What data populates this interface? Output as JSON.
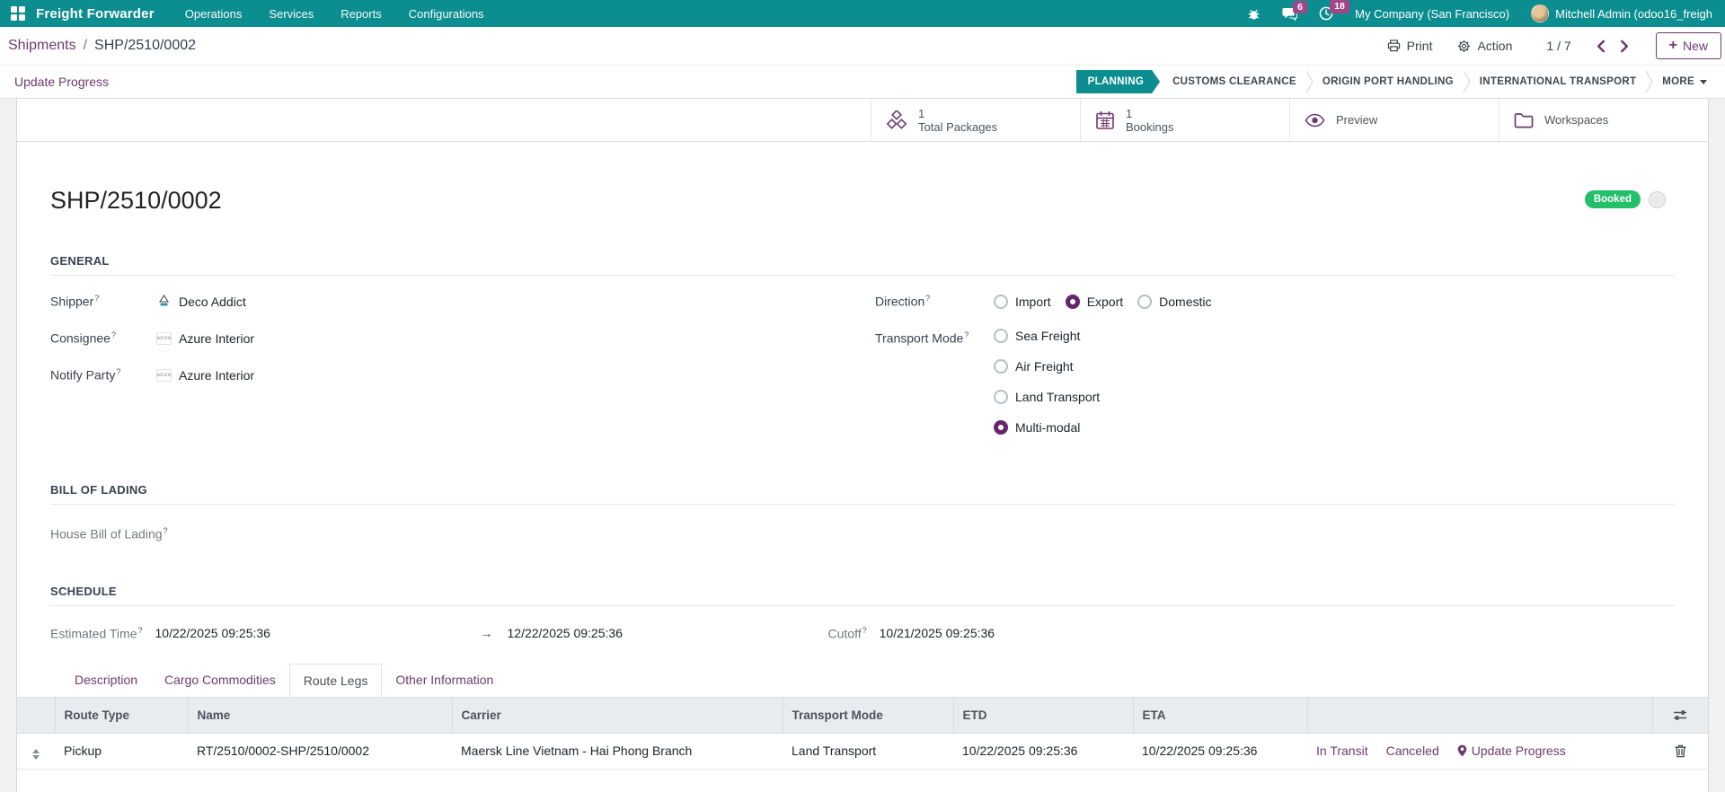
{
  "colors": {
    "navbar_teal": "#0c8d8f",
    "accent_purple": "#6e3a6e",
    "radio_purple": "#65246b",
    "badge_green": "#23bf69",
    "nav_badge_magenta": "#a24689",
    "table_header_bg": "#e9ecef"
  },
  "ui": {
    "help_marker": "?"
  },
  "navbar": {
    "app_name": "Freight Forwarder",
    "menus": [
      {
        "label": "Operations"
      },
      {
        "label": "Services"
      },
      {
        "label": "Reports"
      },
      {
        "label": "Configurations"
      }
    ],
    "messages_badge": "6",
    "activities_badge": "18",
    "company": "My Company (San Francisco)",
    "user": "Mitchell Admin (odoo16_freigh"
  },
  "control_panel": {
    "breadcrumb": {
      "parent": "Shipments",
      "separator": "/",
      "current": "SHP/2510/0002"
    },
    "print_label": "Print",
    "action_label": "Action",
    "pager": "1 / 7",
    "new_plus": "+",
    "new_label": "New"
  },
  "statusbar": {
    "update_progress_label": "Update Progress",
    "active_step": "PLANNING",
    "steps": [
      {
        "label": "PLANNING"
      },
      {
        "label": "CUSTOMS CLEARANCE"
      },
      {
        "label": "ORIGIN PORT HANDLING"
      },
      {
        "label": "INTERNATIONAL TRANSPORT"
      },
      {
        "label": "MORE"
      }
    ]
  },
  "smart_buttons": [
    {
      "icon": "packages-icon",
      "value": "1",
      "label": "Total Packages"
    },
    {
      "icon": "calendar-icon",
      "value": "1",
      "label": "Bookings"
    },
    {
      "icon": "eye-icon",
      "label": "Preview"
    },
    {
      "icon": "folder-icon",
      "label": "Workspaces"
    }
  ],
  "record": {
    "title": "SHP/2510/0002",
    "status_badge": "Booked"
  },
  "general": {
    "heading": "GENERAL",
    "shipper": {
      "label": "Shipper",
      "value": "Deco Addict"
    },
    "consignee": {
      "label": "Consignee",
      "value": "Azure Interior"
    },
    "notify_party": {
      "label": "Notify Party",
      "value": "Azure Interior"
    },
    "direction": {
      "label": "Direction",
      "options": [
        {
          "label": "Import",
          "selected": false
        },
        {
          "label": "Export",
          "selected": true
        },
        {
          "label": "Domestic",
          "selected": false
        }
      ]
    },
    "transport_mode": {
      "label": "Transport Mode",
      "options": [
        {
          "label": "Sea Freight",
          "selected": false
        },
        {
          "label": "Air Freight",
          "selected": false
        },
        {
          "label": "Land Transport",
          "selected": false
        },
        {
          "label": "Multi-modal",
          "selected": true
        }
      ]
    }
  },
  "bill_of_lading": {
    "heading": "BILL OF LADING",
    "house_bl_label": "House Bill of Lading"
  },
  "schedule": {
    "heading": "SCHEDULE",
    "estimated_label": "Estimated Time",
    "start": "10/22/2025 09:25:36",
    "arrow": "→",
    "end": "12/22/2025 09:25:36",
    "cutoff_label": "Cutoff",
    "cutoff_value": "10/21/2025 09:25:36"
  },
  "notebook": {
    "active_tab": "Route Legs",
    "tabs": [
      {
        "label": "Description"
      },
      {
        "label": "Cargo Commodities"
      },
      {
        "label": "Route Legs"
      },
      {
        "label": "Other Information"
      }
    ]
  },
  "route_table": {
    "headers": [
      {
        "label": "Route Type"
      },
      {
        "label": "Name"
      },
      {
        "label": "Carrier"
      },
      {
        "label": "Transport Mode"
      },
      {
        "label": "ETD"
      },
      {
        "label": "ETA"
      }
    ],
    "rows": [
      {
        "route_type": "Pickup",
        "name": "RT/2510/0002-SHP/2510/0002",
        "carrier": "Maersk Line Vietnam - Hai Phong Branch",
        "transport_mode": "Land Transport",
        "etd": "10/22/2025 09:25:36",
        "eta": "10/22/2025 09:25:36",
        "actions": [
          {
            "label": "In Transit"
          },
          {
            "label": "Canceled"
          },
          {
            "label": "Update Progress"
          }
        ]
      }
    ]
  }
}
